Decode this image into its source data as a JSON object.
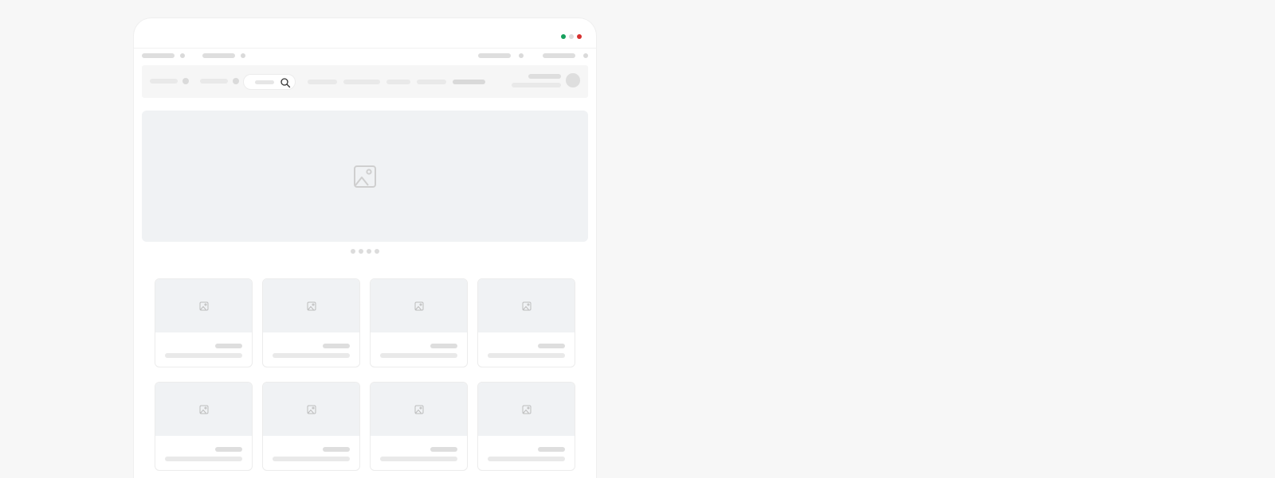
{
  "window": {
    "controls": [
      {
        "name": "green",
        "color": "#16a05d"
      },
      {
        "name": "gray",
        "color": "#dddddd"
      },
      {
        "name": "red",
        "color": "#d6302f"
      }
    ]
  },
  "colors": {
    "placeholder_bar": "#dedede",
    "image_placeholder_bg": "#f0f2f4",
    "navbar_bg": "#f6f6f6",
    "page_bg": "#f7f7f7"
  },
  "icons": {
    "search": "search-icon",
    "hero_image": "image-icon",
    "card_image": "image-icon"
  },
  "carousel": {
    "slides": 4,
    "active_index": 0
  },
  "products": {
    "rows": 2,
    "columns": 4
  }
}
